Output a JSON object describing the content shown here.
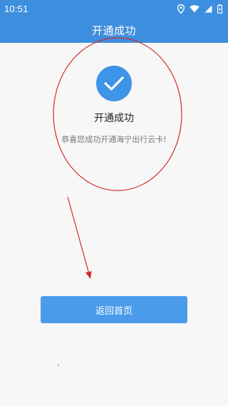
{
  "status_bar": {
    "time": "10:51",
    "icons": [
      "location-icon",
      "wifi-icon",
      "signal-icon",
      "battery-icon"
    ]
  },
  "header": {
    "title": "开通成功"
  },
  "result": {
    "icon": "check-circle-icon",
    "title": "开通成功",
    "message": "恭喜您成功开通海宁出行云卡!"
  },
  "actions": {
    "home_button_label": "返回首页"
  },
  "colors": {
    "primary": "#3e8ee0",
    "button": "#4a9cea",
    "annotation": "#d42b2b",
    "background": "#f7f7f7"
  }
}
